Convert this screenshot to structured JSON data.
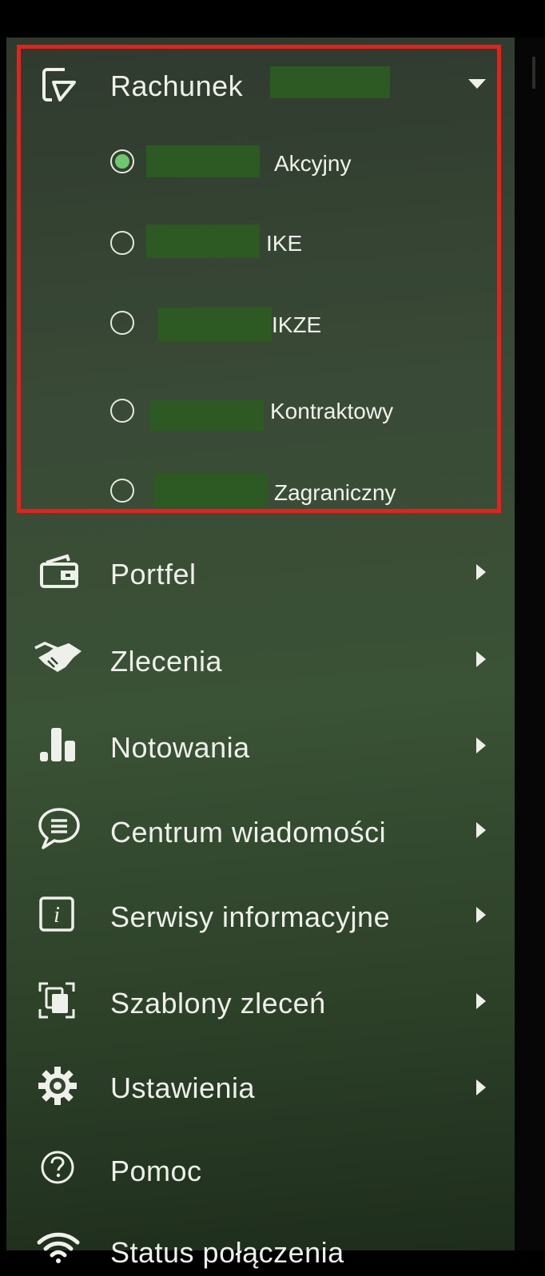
{
  "menu": {
    "account": {
      "label": "Rachunek",
      "options": [
        {
          "label": "Akcyjny",
          "selected": true
        },
        {
          "label": "IKE",
          "selected": false
        },
        {
          "label": "IKZE",
          "selected": false
        },
        {
          "label": "Kontraktowy",
          "selected": false
        },
        {
          "label": "Zagraniczny",
          "selected": false
        }
      ]
    },
    "items": [
      {
        "label": "Portfel",
        "icon": "wallet-icon",
        "has_submenu": true
      },
      {
        "label": "Zlecenia",
        "icon": "handshake-icon",
        "has_submenu": true
      },
      {
        "label": "Notowania",
        "icon": "bar-chart-icon",
        "has_submenu": true
      },
      {
        "label": "Centrum wiadomości",
        "icon": "chat-bubble-icon",
        "has_submenu": true
      },
      {
        "label": "Serwisy informacyjne",
        "icon": "info-icon",
        "has_submenu": true
      },
      {
        "label": "Szablony zleceń",
        "icon": "templates-icon",
        "has_submenu": true
      },
      {
        "label": "Ustawienia",
        "icon": "gear-icon",
        "has_submenu": true
      },
      {
        "label": "Pomoc",
        "icon": "help-icon",
        "has_submenu": false
      },
      {
        "label": "Status połączenia",
        "icon": "wifi-icon",
        "has_submenu": false
      }
    ]
  },
  "colors": {
    "highlight_border": "#e8201c",
    "radio_selected": "#6ec86b",
    "redaction": "#2c5a22"
  }
}
